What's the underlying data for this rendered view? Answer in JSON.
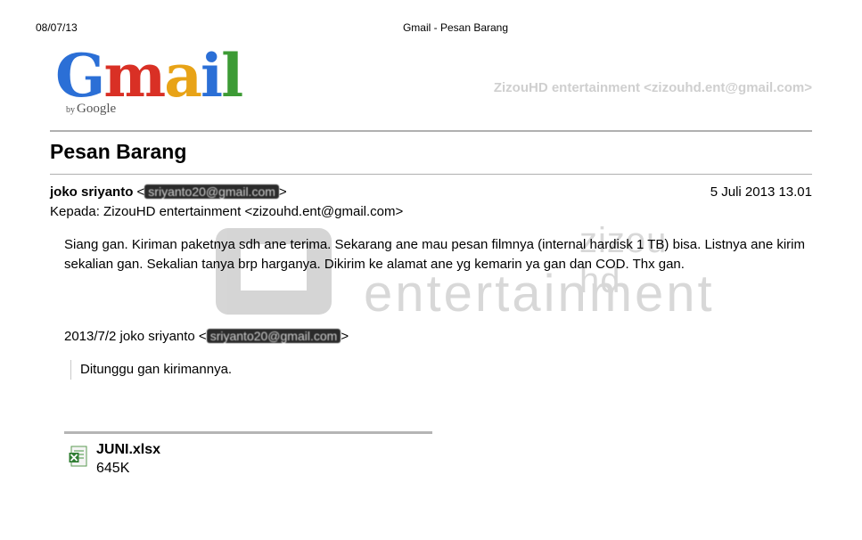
{
  "print_header": {
    "date": "08/07/13",
    "title": "Gmail - Pesan Barang"
  },
  "logo": {
    "letters": [
      {
        "char": "G",
        "color": "#2b6fd6"
      },
      {
        "char": "m",
        "color": "#d93025"
      },
      {
        "char": "a",
        "color": "#e8a317"
      },
      {
        "char": "i",
        "color": "#2b6fd6"
      },
      {
        "char": "l",
        "color": "#3d9b35"
      }
    ],
    "byline_prefix": "by",
    "byline_brand": "Google"
  },
  "account": "ZizouHD entertainment <zizouhd.ent@gmail.com>",
  "subject": "Pesan Barang",
  "message": {
    "sender_name": "joko sriyanto",
    "sender_email_redacted": "sriyanto20@gmail.com",
    "date": "5 Juli 2013 13.01",
    "to": "Kepada: ZizouHD entertainment <zizouhd.ent@gmail.com>",
    "body": "Siang gan. Kiriman paketnya sdh ane terima. Sekarang ane mau pesan filmnya (internal hardisk 1 TB) bisa. Listnya ane kirim sekalian gan. Sekalian tanya brp harganya. Dikirim ke alamat ane yg kemarin ya gan dan COD. Thx gan.",
    "quote_header": "2013/7/2 joko sriyanto",
    "quote_email_redacted": "sriyanto20@gmail.com",
    "quote_text": "Ditunggu gan kirimannya."
  },
  "attachment": {
    "name": "JUNI.xlsx",
    "size": "645K",
    "icon": "excel-file-icon"
  },
  "watermark": {
    "line1": "zizou hd",
    "line2": "entertainment"
  }
}
